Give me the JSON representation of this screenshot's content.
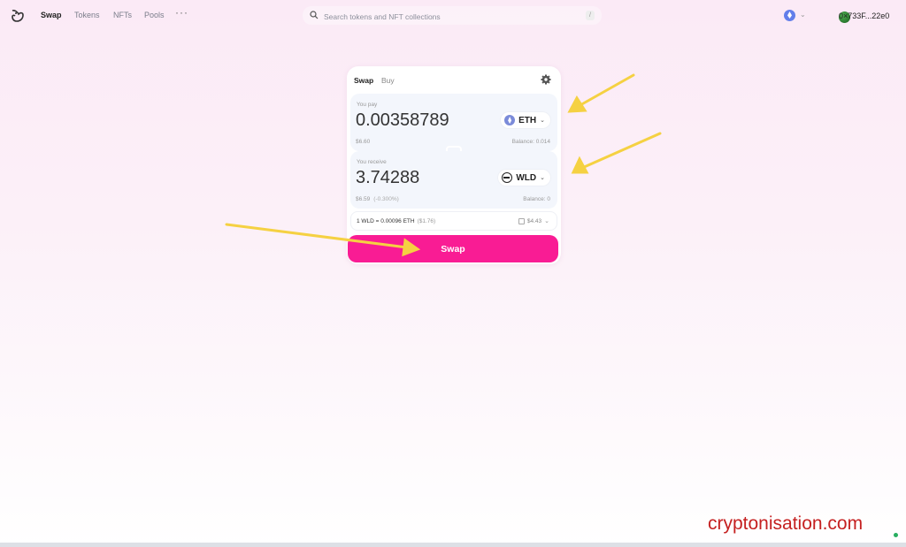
{
  "nav": {
    "items": [
      {
        "label": "Swap",
        "active": true
      },
      {
        "label": "Tokens",
        "active": false
      },
      {
        "label": "NFTs",
        "active": false
      },
      {
        "label": "Pools",
        "active": false
      }
    ],
    "more_label": "···",
    "search_placeholder": "Search tokens and NFT collections",
    "search_shortcut": "/",
    "network_icon": "ethereum-icon",
    "account_label": "0×733F...22e0"
  },
  "swap_card": {
    "tabs": [
      "Swap",
      "Buy"
    ],
    "settings_icon": "gear-icon",
    "pay": {
      "label": "You pay",
      "amount": "0.00358789",
      "token": "ETH",
      "usd": "$6.60",
      "balance": "Balance: 0.014"
    },
    "switch_icon": "arrow-down-icon",
    "receive": {
      "label": "You receive",
      "amount": "3.74288",
      "token": "WLD",
      "usd": "$6.59",
      "usd_change": "(-0.300%)",
      "balance": "Balance: 0"
    },
    "rate": {
      "text": "1 WLD = 0.00096 ETH",
      "usd": "($1.76)",
      "gas": "$4.43"
    },
    "swap_button": "Swap"
  },
  "watermark": "cryptonisation.com",
  "colors": {
    "accent": "#f91c94",
    "annotation_arrow": "#f5d142",
    "watermark": "#c52020"
  }
}
